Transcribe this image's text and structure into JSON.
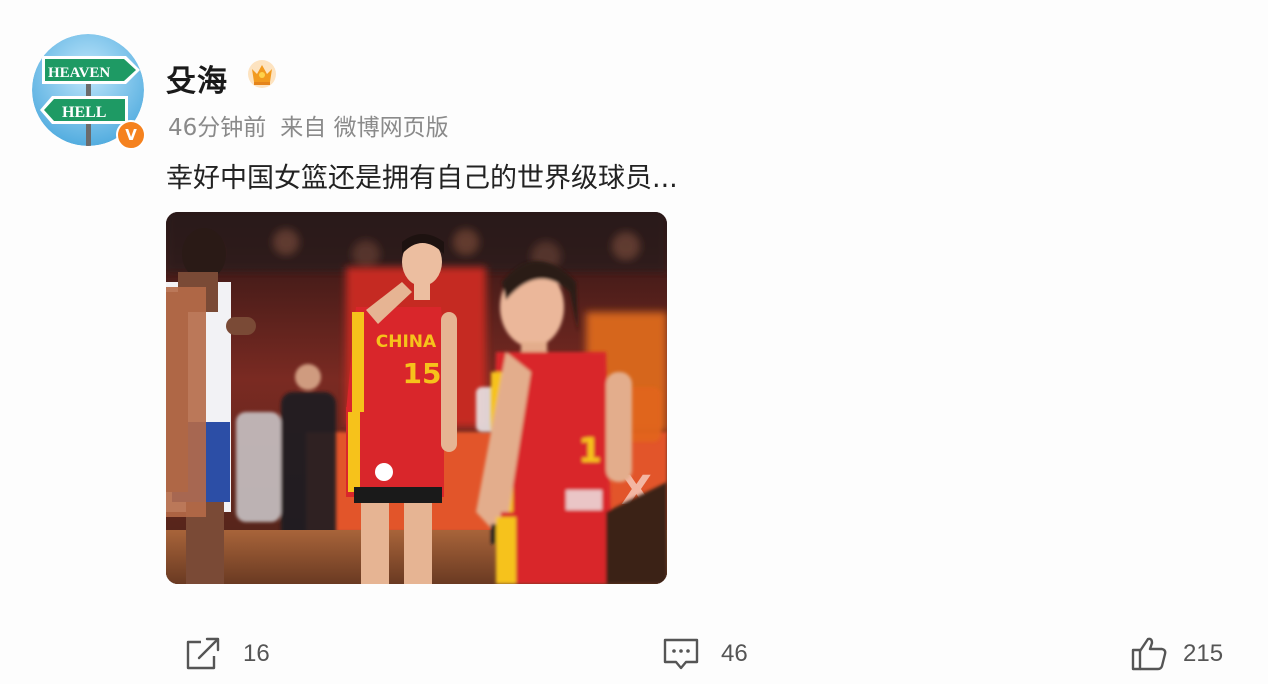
{
  "post": {
    "author": {
      "name": "殳海",
      "avatar_text_top": "HEAVEN",
      "avatar_text_bottom": "HELL",
      "verified_badge": "V",
      "badge_icon": "crown-badge-icon"
    },
    "meta": {
      "time": "46分钟前",
      "source": "来自 微博网页版"
    },
    "text": "幸好中国女篮还是拥有自己的世界级球员...",
    "image": {
      "description_icon": "basketball-photo",
      "jersey_text": "CHINA",
      "jersey_number": "15",
      "second_number": "1"
    },
    "actions": {
      "share_count": "16",
      "comment_count": "46",
      "like_count": "215"
    }
  },
  "colors": {
    "badge_orange": "#f5821f",
    "meta_gray": "#8a8a8a",
    "jersey_red": "#d9262b",
    "jersey_yellow": "#f6c21b"
  }
}
